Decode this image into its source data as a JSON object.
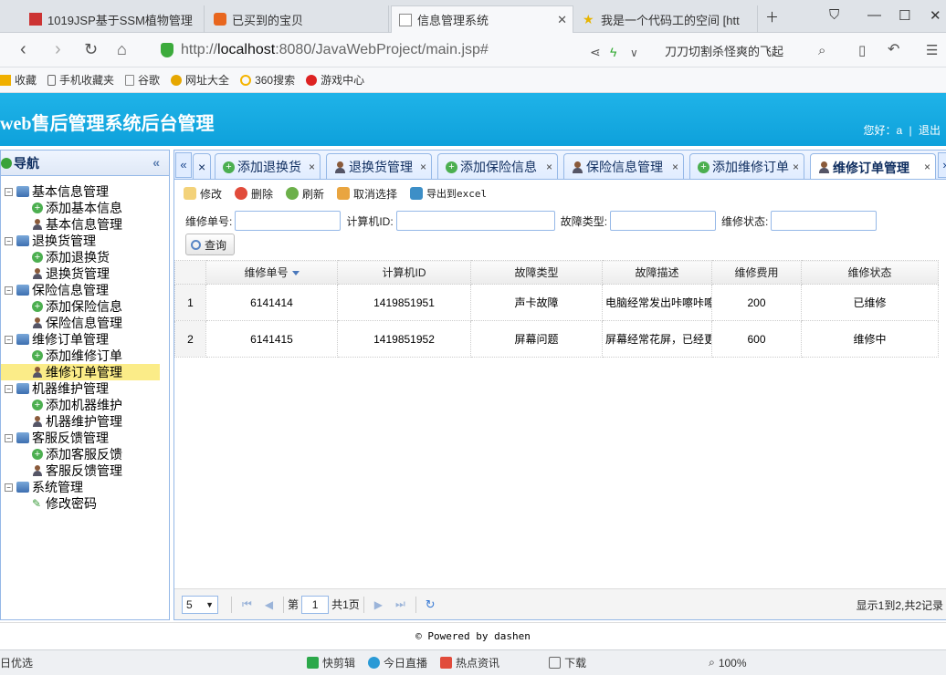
{
  "browser": {
    "tabs": [
      {
        "title": "1019JSP基于SSM植物管理",
        "active": false
      },
      {
        "title": "已买到的宝贝",
        "active": false
      },
      {
        "title": "信息管理系统",
        "active": true
      },
      {
        "title": "我是一个代码工的空间 [htt",
        "active": false
      }
    ],
    "url": {
      "prefix": "http://",
      "host": "localhost",
      "rest": ":8080/JavaWebProject/main.jsp#"
    },
    "search_text": "刀刀切割杀怪爽的飞起",
    "bookmarks": [
      "收藏",
      "手机收藏夹",
      "谷歌",
      "网址大全",
      "360搜索",
      "游戏中心"
    ]
  },
  "app": {
    "title": "web售后管理系统后台管理",
    "greeting": "您好：a",
    "logout": "退出"
  },
  "sidebar": {
    "title": "导航",
    "groups": [
      {
        "label": "基本信息管理",
        "items": [
          {
            "label": "添加基本信息",
            "icon": "add"
          },
          {
            "label": "基本信息管理",
            "icon": "user"
          }
        ]
      },
      {
        "label": "退换货管理",
        "items": [
          {
            "label": "添加退换货",
            "icon": "add"
          },
          {
            "label": "退换货管理",
            "icon": "user"
          }
        ]
      },
      {
        "label": "保险信息管理",
        "items": [
          {
            "label": "添加保险信息",
            "icon": "add"
          },
          {
            "label": "保险信息管理",
            "icon": "user"
          }
        ]
      },
      {
        "label": "维修订单管理",
        "items": [
          {
            "label": "添加维修订单",
            "icon": "add"
          },
          {
            "label": "维修订单管理",
            "icon": "user",
            "selected": true
          }
        ]
      },
      {
        "label": "机器维护管理",
        "items": [
          {
            "label": "添加机器维护",
            "icon": "add"
          },
          {
            "label": "机器维护管理",
            "icon": "user"
          }
        ]
      },
      {
        "label": "客服反馈管理",
        "items": [
          {
            "label": "添加客服反馈",
            "icon": "add"
          },
          {
            "label": "客服反馈管理",
            "icon": "user"
          }
        ]
      },
      {
        "label": "系统管理",
        "items": [
          {
            "label": "修改密码",
            "icon": "pen"
          }
        ]
      }
    ]
  },
  "tabs": [
    {
      "label": "添加退换货",
      "icon": "add"
    },
    {
      "label": "退换货管理",
      "icon": "user"
    },
    {
      "label": "添加保险信息",
      "icon": "add"
    },
    {
      "label": "保险信息管理",
      "icon": "user"
    },
    {
      "label": "添加维修订单",
      "icon": "add"
    },
    {
      "label": "维修订单管理",
      "icon": "user",
      "active": true
    }
  ],
  "toolbar": {
    "edit": "修改",
    "delete": "删除",
    "refresh": "刷新",
    "cancel_select": "取消选择",
    "export": "导出到excel"
  },
  "filters": {
    "order_no_label": "维修单号:",
    "computer_id_label": "计算机ID:",
    "fault_type_label": "故障类型:",
    "status_label": "维修状态:",
    "query_button": "查询"
  },
  "grid": {
    "columns": [
      "维修单号",
      "计算机ID",
      "故障类型",
      "故障描述",
      "维修费用",
      "维修状态"
    ],
    "rows": [
      {
        "rn": "1",
        "order_no": "6141414",
        "computer_id": "1419851951",
        "fault_type": "声卡故障",
        "desc": "电脑经常发出咔嚓咔嚓的",
        "cost": "200",
        "status": "已维修"
      },
      {
        "rn": "2",
        "order_no": "6141415",
        "computer_id": "1419851952",
        "fault_type": "屏幕问题",
        "desc": "屏幕经常花屏，已经更换",
        "cost": "600",
        "status": "维修中"
      }
    ]
  },
  "pager": {
    "page_size": "5",
    "page_prefix": "第",
    "page_value": "1",
    "page_suffix": "共1页",
    "info": "显示1到2,共2记录"
  },
  "footer": "© Powered by dashen",
  "statusbar": [
    "日优选",
    "快剪辑",
    "今日直播",
    "热点资讯",
    "下载",
    "100%"
  ],
  "colors": {
    "header": "#0ea1db",
    "border": "#95b8e7",
    "selected": "#fbec88"
  }
}
